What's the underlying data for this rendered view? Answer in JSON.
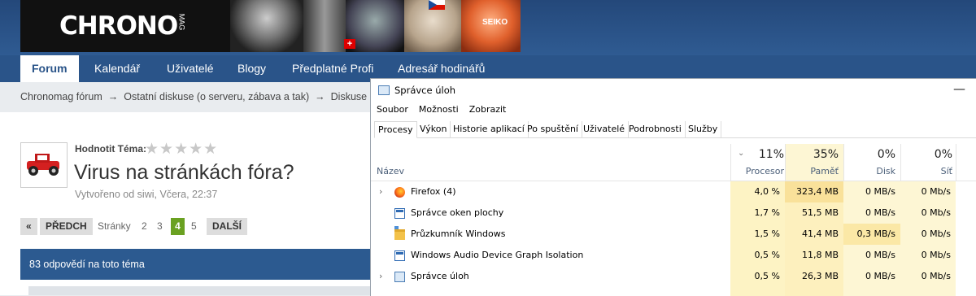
{
  "forum": {
    "banner": {
      "logo_text": "CHRONO",
      "logo_sub": "MAG",
      "brand_on_watch": "SEIKO"
    },
    "nav": {
      "tabs": [
        "Forum",
        "Kalendář",
        "Uživatelé",
        "Blogy",
        "Předplatné Profi",
        "Adresář hodinářů"
      ]
    },
    "breadcrumb": {
      "items": [
        "Chronomag fórum",
        "Ostatní diskuse (o serveru, zábava a tak)",
        "Diskuse k se"
      ],
      "separator": "→"
    },
    "thread": {
      "rate_label": "Hodnotit Téma:",
      "stars": "★★★★★",
      "title": "Virus na stránkách fóra?",
      "meta": "Vytvořeno od siwi, Včera, 22:37"
    },
    "pager": {
      "first": "«",
      "prev": "PŘEDCH",
      "pages_label": "Stránky",
      "pages": [
        "2",
        "3",
        "4",
        "5"
      ],
      "current": "4",
      "next": "DALŠÍ"
    },
    "replies_text": "83 odpovědí na toto téma"
  },
  "taskmgr": {
    "title": "Správce úloh",
    "minimize": "—",
    "menu": [
      "Soubor",
      "Možnosti",
      "Zobrazit"
    ],
    "tabs": [
      "Procesy",
      "Výkon",
      "Historie aplikací",
      "Po spuštění",
      "Uživatelé",
      "Podrobnosti",
      "Služby"
    ],
    "active_tab": "Procesy",
    "columns": {
      "name": "Název",
      "sort_indicator": "⌄",
      "cpu": {
        "pct": "11%",
        "label": "Procesor"
      },
      "mem": {
        "pct": "35%",
        "label": "Paměť"
      },
      "disk": {
        "pct": "0%",
        "label": "Disk"
      },
      "net": {
        "pct": "0%",
        "label": "Síť"
      }
    },
    "processes": [
      {
        "expand": "›",
        "name": "Firefox (4)",
        "icon": "firefox-icon",
        "cpu": "4,0 %",
        "mem": "323,4 MB",
        "disk": "0 MB/s",
        "net": "0 Mb/s"
      },
      {
        "expand": "",
        "name": "Správce oken plochy",
        "icon": "window-icon",
        "cpu": "1,7 %",
        "mem": "51,5 MB",
        "disk": "0 MB/s",
        "net": "0 Mb/s"
      },
      {
        "expand": "",
        "name": "Průzkumník Windows",
        "icon": "folder-icon",
        "cpu": "1,5 %",
        "mem": "41,4 MB",
        "disk": "0,3 MB/s",
        "net": "0 Mb/s"
      },
      {
        "expand": "",
        "name": "Windows Audio Device Graph Isolation",
        "icon": "window-icon",
        "cpu": "0,5 %",
        "mem": "11,8 MB",
        "disk": "0 MB/s",
        "net": "0 Mb/s"
      },
      {
        "expand": "›",
        "name": "Správce úloh",
        "icon": "taskmgr-icon",
        "cpu": "0,5 %",
        "mem": "26,3 MB",
        "disk": "0 MB/s",
        "net": "0 Mb/s"
      }
    ],
    "colors": {
      "cpu_cell": "#fdf3c4",
      "mem_cell_high": "#f9e19a",
      "mem_cell": "#fdf0be",
      "disk_cell_active": "#fbe8a6",
      "disk_cell": "#fdf6d4",
      "net_cell": "#fdf6d4"
    }
  }
}
